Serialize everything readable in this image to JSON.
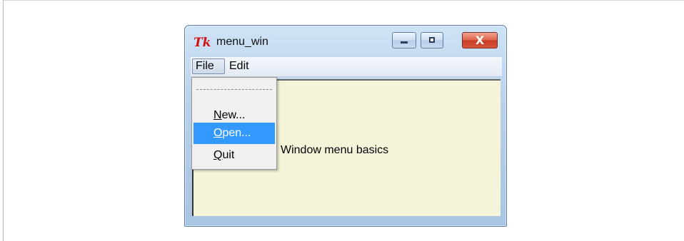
{
  "window": {
    "title": "menu_win",
    "icon": "tk-feather-icon",
    "controls": {
      "minimize": "minimize-icon",
      "maximize": "maximize-icon",
      "close": "close-icon",
      "close_glyph": "X"
    }
  },
  "menubar": {
    "items": [
      {
        "label": "File",
        "active": true
      },
      {
        "label": "Edit",
        "active": false
      }
    ]
  },
  "dropdown": {
    "tearoff_visible": true,
    "items": [
      {
        "label": "New...",
        "underline_char": "N",
        "highlighted": false
      },
      {
        "label": "Open...",
        "underline_char": "O",
        "highlighted": true
      },
      {
        "label": "Quit",
        "underline_char": "Q",
        "highlighted": false
      }
    ]
  },
  "content": {
    "label": "Window menu basics",
    "background": "#f6f4d8"
  },
  "colors": {
    "highlight": "#3399ff",
    "close_button": "#d8553b"
  }
}
